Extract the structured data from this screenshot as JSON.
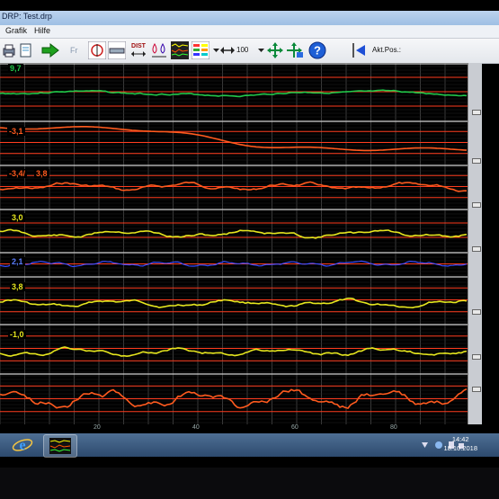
{
  "window": {
    "title": "DRP:  Test.drp"
  },
  "menu": [
    {
      "label": "Grafik"
    },
    {
      "label": "Hilfe"
    }
  ],
  "toolbar": {
    "fr_label": "Fr",
    "dist_label": "DIST",
    "zoom_value": "100",
    "position_label": "Akt.Pos.:"
  },
  "channels": [
    {
      "label": "9,7",
      "color": "#22c84a",
      "label_color": "#22c84a"
    },
    {
      "label": "-3,1",
      "color": "#ff5a1e",
      "label_color": "#ff5a1e"
    },
    {
      "label": "-3,4/",
      "label2": "3,8",
      "color": "#ff5a1e",
      "label_color": "#ff5a1e"
    },
    {
      "label": "3,0",
      "color": "#e6e61e",
      "label_color": "#e6e61e"
    },
    {
      "label": "2,1",
      "color": "#3a4cff",
      "label_color": "#5a7cff"
    },
    {
      "label": "3,8",
      "color": "#e6e61e",
      "label_color": "#e6e61e"
    },
    {
      "label": "-1,0",
      "color": "#e6e61e",
      "label_color": "#e6e61e"
    },
    {
      "label": "",
      "color": "#ff5a1e",
      "label_color": "#ff5a1e"
    }
  ],
  "x_ticks": [
    "20",
    "40",
    "60",
    "80"
  ],
  "taskbar": {
    "time": "14:42",
    "date": "18.10.2018"
  },
  "colors": {
    "grid": "#3a3a3a",
    "ref_line": "#ff3c1e",
    "separator": "#cfcfcf"
  }
}
